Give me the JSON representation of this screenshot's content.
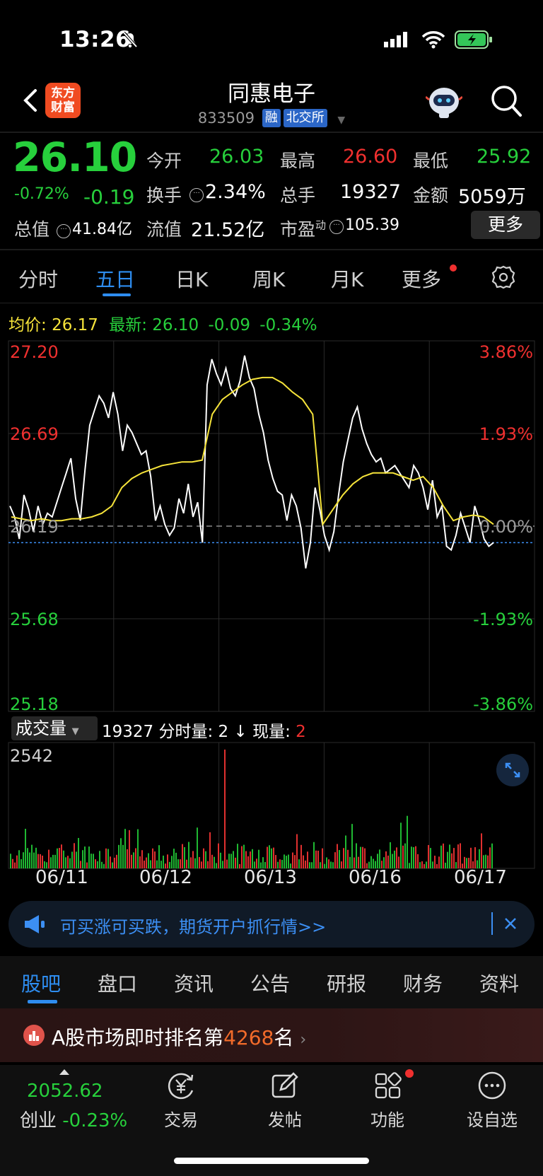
{
  "status_bar": {
    "time": "13:26"
  },
  "header": {
    "logo_text": "东方财富",
    "stock_name": "同惠电子",
    "stock_code": "833509",
    "tag_margin": "融",
    "tag_exchange": "北交所"
  },
  "quote": {
    "price": "26.10",
    "change_pct": "-0.72%",
    "change": "-0.19",
    "open_label": "今开",
    "open": "26.03",
    "high_label": "最高",
    "high": "26.60",
    "low_label": "最低",
    "low": "25.92",
    "turnover_label": "换手",
    "turnover": "2.34%",
    "volume_label": "总手",
    "volume": "19327",
    "amount_label": "金额",
    "amount": "5059万",
    "mktcap_label": "总值",
    "mktcap": "41.84亿",
    "float_label": "流值",
    "float": "21.52亿",
    "pe_label": "市盈",
    "pe_sup": "动",
    "pe": "105.39",
    "more_button": "更多"
  },
  "chart_tabs": [
    "分时",
    "五日",
    "日K",
    "周K",
    "月K",
    "更多"
  ],
  "chart_info": {
    "avg_label": "均价:",
    "avg": "26.17",
    "latest_label": "最新:",
    "latest": "26.10",
    "latest_chg": "-0.09",
    "latest_pct": "-0.34%"
  },
  "chart_data": {
    "type": "line",
    "y_left_ticks": [
      "27.20",
      "26.69",
      "26.19",
      "25.68",
      "25.18"
    ],
    "y_right_ticks": [
      "3.86%",
      "1.93%",
      "0.00%",
      "-1.93%",
      "-3.86%"
    ],
    "x_labels": [
      "06/11",
      "06/12",
      "06/13",
      "06/16",
      "06/17"
    ],
    "ylim": [
      25.18,
      27.2
    ],
    "reference_price": 26.19,
    "current_price": 26.1,
    "series": [
      {
        "name": "价格",
        "color": "#ffffff",
        "values": [
          26.3,
          26.24,
          26.12,
          26.36,
          26.28,
          26.16,
          26.3,
          26.2,
          26.26,
          26.24,
          26.32,
          26.4,
          26.48,
          26.56,
          26.34,
          26.22,
          26.5,
          26.74,
          26.82,
          26.9,
          26.86,
          26.78,
          26.92,
          26.8,
          26.6,
          26.74,
          26.7,
          26.64,
          26.58,
          26.6,
          26.46,
          26.22,
          26.3,
          26.2,
          26.14,
          26.18,
          26.34,
          26.26,
          26.42,
          26.24,
          26.32,
          26.1,
          26.96,
          27.1,
          27.02,
          26.96,
          27.05,
          26.94,
          26.9,
          26.98,
          27.12,
          27.0,
          26.94,
          26.8,
          26.7,
          26.55,
          26.45,
          26.38,
          26.36,
          26.22,
          26.36,
          26.3,
          26.18,
          25.96,
          26.1,
          26.4,
          26.28,
          26.14,
          26.06,
          26.16,
          26.36,
          26.54,
          26.66,
          26.78,
          26.84,
          26.72,
          26.64,
          26.58,
          26.54,
          26.56,
          26.48,
          26.5,
          26.52,
          26.48,
          26.44,
          26.4,
          26.52,
          26.48,
          26.4,
          26.28,
          26.44,
          26.24,
          26.3,
          26.08,
          26.06,
          26.14,
          26.26,
          26.18,
          26.1,
          26.3,
          26.22,
          26.12,
          26.08,
          26.1
        ]
      },
      {
        "name": "均价",
        "color": "#f5e33a",
        "values": [
          26.24,
          26.23,
          26.22,
          26.23,
          26.22,
          26.22,
          26.23,
          26.23,
          26.24,
          26.26,
          26.3,
          26.4,
          26.45,
          26.48,
          26.5,
          26.52,
          26.53,
          26.54,
          26.54,
          26.55,
          26.8,
          26.88,
          26.92,
          26.96,
          26.99,
          27.0,
          27.0,
          26.97,
          26.92,
          26.88,
          26.8,
          26.2,
          26.28,
          26.36,
          26.42,
          26.46,
          26.48,
          26.48,
          26.48,
          26.46,
          26.44,
          26.46,
          26.4,
          26.3,
          26.22,
          26.24,
          26.25,
          26.24,
          26.2
        ]
      }
    ]
  },
  "volume": {
    "selector": "成交量",
    "total": "19327",
    "tick_label": "分时量:",
    "tick_value": "2",
    "arrow": "↓",
    "now_label": "现量:",
    "now_value": "2",
    "max_label": "2542"
  },
  "banner": {
    "text": "可买涨可买跌，期货开户抓行情>>"
  },
  "section_tabs": [
    "股吧",
    "盘口",
    "资讯",
    "公告",
    "研报",
    "财务",
    "资料"
  ],
  "rank": {
    "prefix": "A股市场即时排名第",
    "number": "4268",
    "suffix": "名"
  },
  "bottom_nav": {
    "index_value": "2052.62",
    "index_name": "创业",
    "index_pct": "-0.23%",
    "items": [
      "交易",
      "发帖",
      "功能",
      "设自选"
    ]
  },
  "colors": {
    "up": "#f0302f",
    "down": "#27d03c",
    "accent": "#2e8df0",
    "avg_line": "#f5e33a"
  }
}
